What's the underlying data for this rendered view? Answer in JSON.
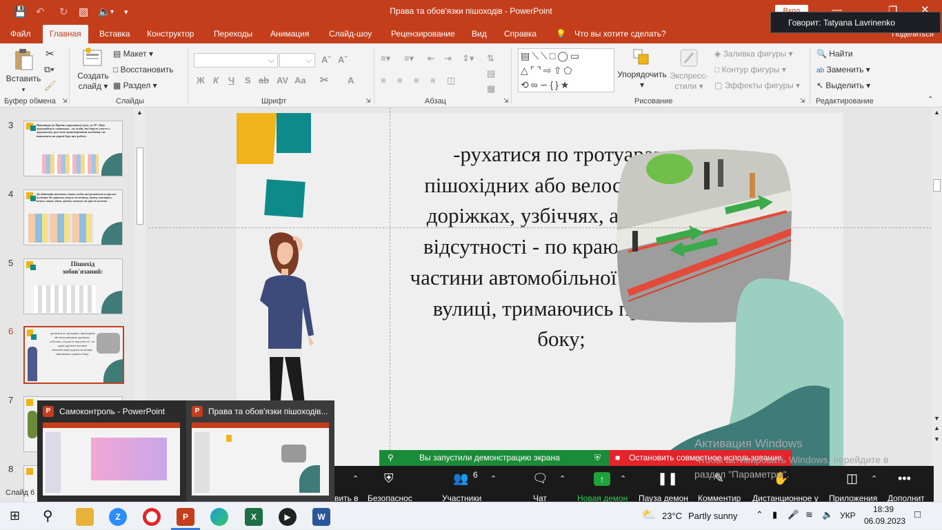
{
  "window": {
    "doc_title": "Права та обов'язки пішоходів  -  PowerPoint",
    "login_label": "Вход",
    "speaking_text": "Говорит: Tatyana Lavrinenko",
    "share_label": "Поделиться"
  },
  "tabs": [
    "Файл",
    "Главная",
    "Вставка",
    "Конструктор",
    "Переходы",
    "Анимация",
    "Слайд-шоу",
    "Рецензирование",
    "Вид",
    "Справка"
  ],
  "tell_me": "Что вы хотите сделать?",
  "ribbon": {
    "groups": {
      "clipboard": "Буфер обмена",
      "slides": "Слайды",
      "font": "Шрифт",
      "paragraph": "Абзац",
      "drawing": "Рисование",
      "editing": "Редактирование"
    },
    "paste": "Вставить",
    "new_slide_l1": "Создать",
    "new_slide_l2": "слайд",
    "layout": "Макет",
    "reset": "Восстановить",
    "section": "Раздел",
    "arrange": "Упорядочить",
    "quick_styles_l1": "Экспресс-",
    "quick_styles_l2": "стили",
    "shape_fill": "Заливка фигуры",
    "shape_outline": "Контур фигуры",
    "shape_effects": "Эффекты фигуры",
    "find": "Найти",
    "replace": "Заменить",
    "select": "Выделить",
    "font_fmt": [
      "Ж",
      "К",
      "Ч",
      "S",
      "ab",
      "AV",
      "Aa",
      "A"
    ]
  },
  "slides": [
    {
      "num": "3",
      "text": "Відповідно до Правил дорожнього руху та ЗУ «Про дорожній рух» пішоходи – це особи, які беруть участь у дорожньому русі поза транспортними засобами і не виконують на дорозі будь-яку роботу."
    },
    {
      "num": "4",
      "text": "До пішоходів належать також особи, які рухаються в кріслах колісних без двигуна, ведуть велосипед, мопед, мотоцикл, везуть санки, візок, дитячу коляску чи крісло колісне."
    },
    {
      "num": "5",
      "text": "Пішохід зобов'язаний:"
    },
    {
      "num": "6",
      "text": "-рухатися по тротуарах, пішохідних або велосипедних доріжках, узбіччях, а в разі їх відсутності - по краю проїзної частини автомобільної дороги чи вулиці, тримаючись правого боку;"
    },
    {
      "num": "7",
      "text": ""
    },
    {
      "num": "8",
      "text": ""
    }
  ],
  "slide_main_text": "-рухатися по тротуарах, пішохідних або велосипедних доріжках, узбіччях, а в разі їх відсутності - по краю проїзної частини автомобільної дороги чи вулиці, тримаючись правого боку;",
  "taskbar_popup": [
    {
      "title": "Самоконтроль - PowerPoint"
    },
    {
      "title": "Права та обов'язки пішоходів..."
    }
  ],
  "share": {
    "started": "Вы запустили демонстрацию экрана",
    "stop": "Остановить совместное использование"
  },
  "zoom_toolbar": {
    "participants_count": "6",
    "buttons": [
      "вить в",
      "Безопаснос",
      "Участники",
      "Чат",
      "Новая демон",
      "Пауза демон",
      "Комментир",
      "Дистанционное у",
      "Приложения",
      "Дополнит"
    ]
  },
  "activation": {
    "title": "Активация Windows",
    "line1": "Чтобы активировать Windows, перейдите в",
    "line2": "раздел \"Параметры\"."
  },
  "status": {
    "slide_info": "Слайд 6 и"
  },
  "taskbar": {
    "weather_temp": "23°C",
    "weather_desc": "Partly sunny",
    "lang": "УКР",
    "time": "18:39",
    "date": "06.09.2023"
  },
  "colors": {
    "accent": "#c43e1c",
    "teal": "#0f8a8a",
    "gold": "#f0b31a",
    "mint": "#9bcfc0",
    "darkteal": "#3f7b78"
  }
}
